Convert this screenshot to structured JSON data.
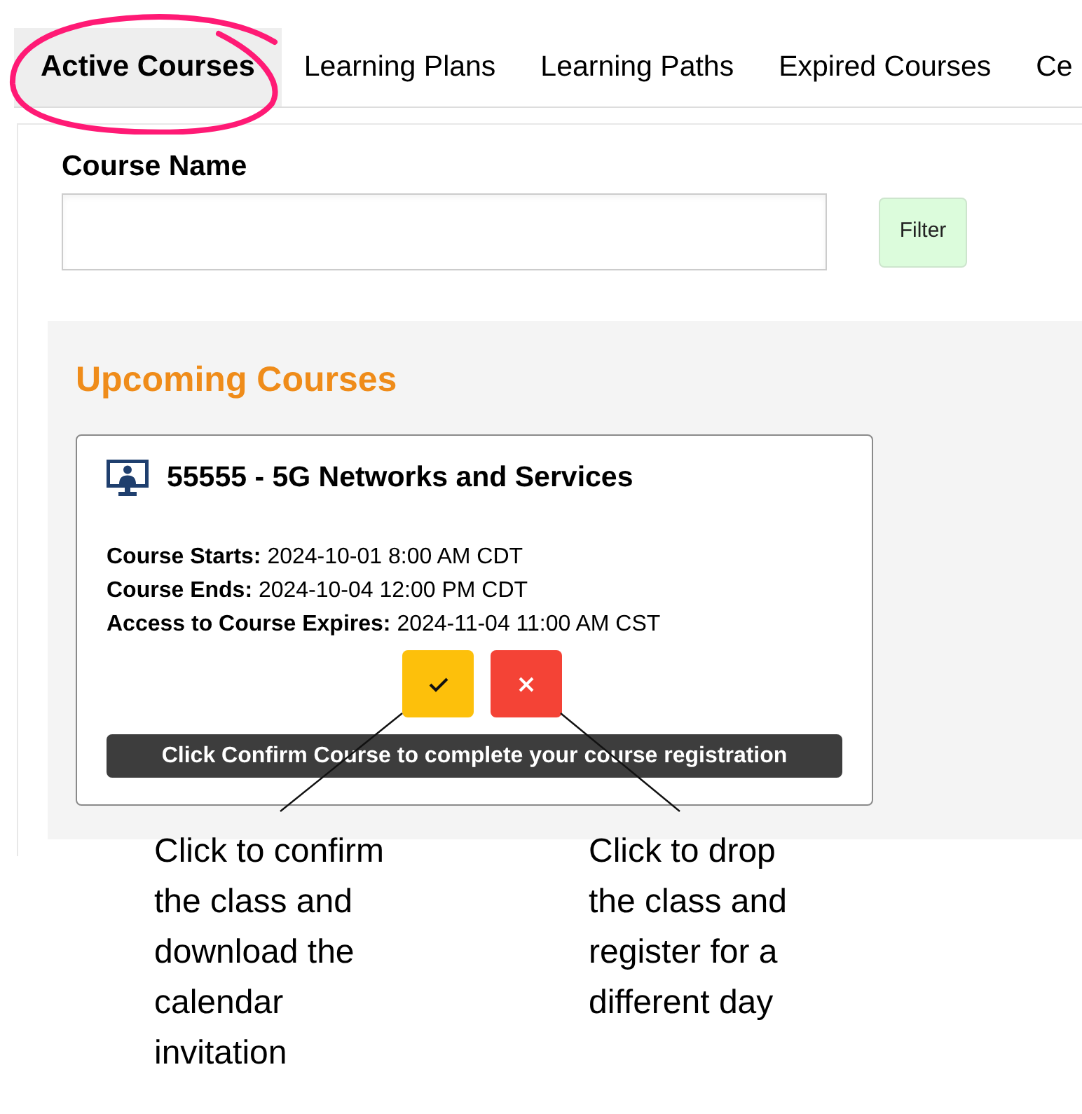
{
  "tabs": [
    {
      "label": "Active Courses",
      "selected": true,
      "circled": true
    },
    {
      "label": "Learning Plans",
      "selected": false,
      "circled": false
    },
    {
      "label": "Learning Paths",
      "selected": false,
      "circled": false
    },
    {
      "label": "Expired Courses",
      "selected": false,
      "circled": false
    },
    {
      "label": "Ce",
      "selected": false,
      "circled": false
    }
  ],
  "filter": {
    "label": "Course Name",
    "button": "Filter"
  },
  "upcoming": {
    "title": "Upcoming Courses",
    "courses": [
      {
        "title": "55555 - 5G Networks and Services",
        "details": [
          {
            "label": "Course Starts:",
            "value": "2024-10-01 8:00 AM CDT"
          },
          {
            "label": "Course Ends:",
            "value": "2024-10-04 12:00 PM CDT"
          },
          {
            "label": "Access to Course Expires:",
            "value": "2024-11-04 11:00 AM CST"
          }
        ],
        "actions": [
          {
            "kind": "confirm"
          },
          {
            "kind": "drop"
          }
        ],
        "notice": "Click Confirm Course to complete your course registration"
      }
    ]
  },
  "callouts": [
    {
      "text": "Click to confirm the class and download the calendar invitation"
    },
    {
      "text": "Click to drop the class and register for a different day"
    }
  ]
}
